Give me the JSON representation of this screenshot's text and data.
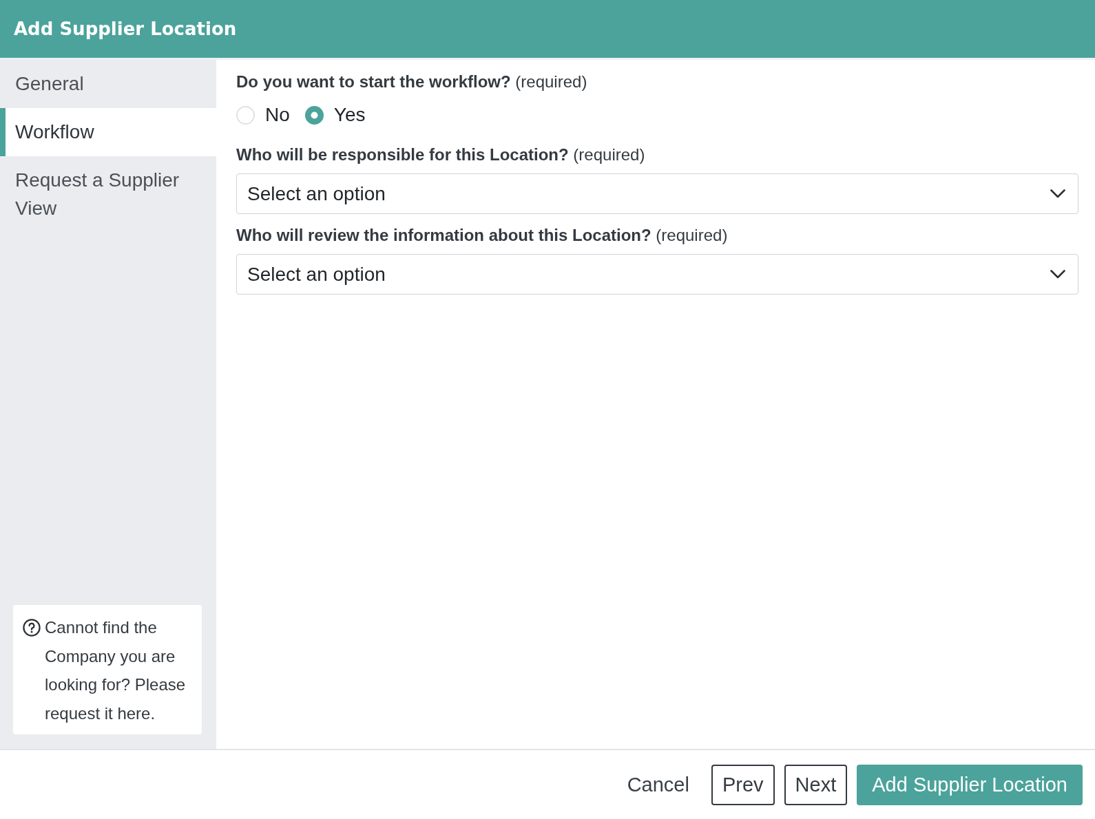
{
  "header": {
    "title": "Add Supplier Location"
  },
  "sidebar": {
    "items": [
      {
        "label": "General",
        "selected": false
      },
      {
        "label": "Workflow",
        "selected": true
      },
      {
        "label": "Request a Supplier View",
        "selected": false
      }
    ],
    "help": {
      "text": "Cannot find the Company you are looking for? Please request it here."
    }
  },
  "form": {
    "fields": [
      {
        "kind": "radio",
        "label": "**Do you want to start the workflow?** (required)",
        "options": [
          {
            "label": "No",
            "selected": false
          },
          {
            "label": "Yes",
            "selected": true
          }
        ]
      },
      {
        "kind": "select",
        "label": "**Who will be responsible for this Location?** (required)",
        "placeholder": "Select an option"
      },
      {
        "kind": "select",
        "label": "**Who will review the information about this Location?** (required)",
        "placeholder": "Select an option"
      }
    ]
  },
  "footer": {
    "buttons": [
      {
        "kind": "link",
        "label": "Cancel"
      },
      {
        "kind": "outline",
        "label": "Prev"
      },
      {
        "kind": "outline",
        "label": "Next"
      },
      {
        "kind": "primary",
        "label": "Add Supplier Location"
      }
    ]
  }
}
